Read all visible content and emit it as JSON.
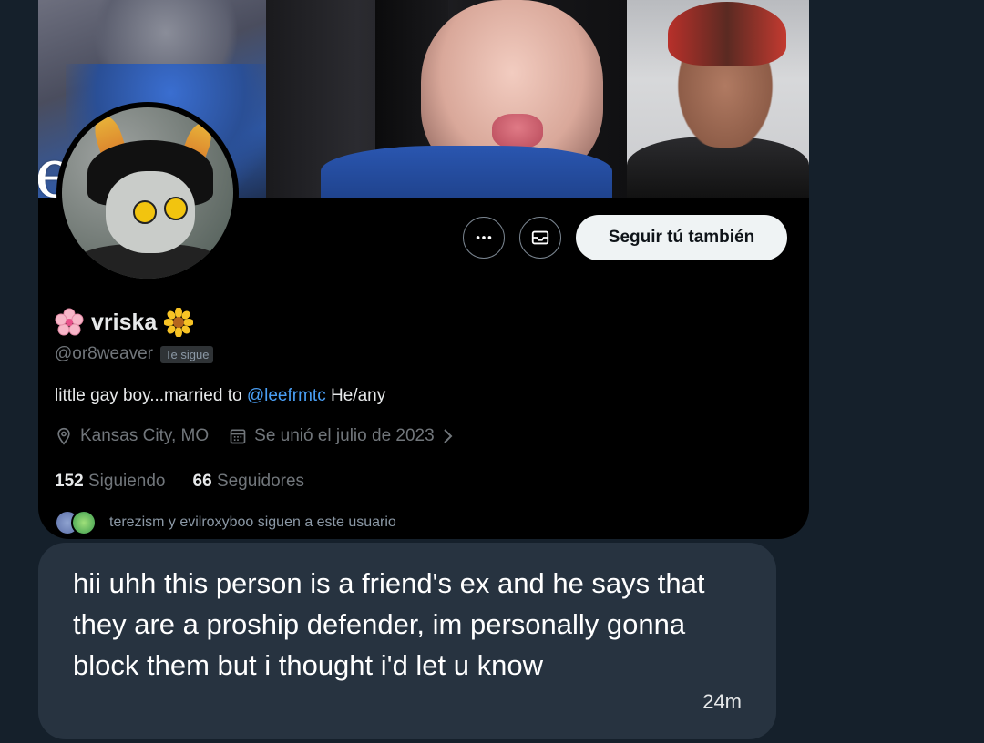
{
  "profile": {
    "banner_text": "eaver",
    "display_name": "vriska",
    "left_emoji": "cherry-blossom-icon",
    "right_emoji": "sunflower-icon",
    "handle": "@or8weaver",
    "follows_you_badge": "Te sigue",
    "bio_prefix": "little gay boy...married to ",
    "bio_mention": "@leefrmtc",
    "bio_suffix": " He/any",
    "location": "Kansas City, MO",
    "joined": "Se unió el julio de 2023",
    "following_count": "152",
    "following_label": "Siguiendo",
    "followers_count": "66",
    "followers_label": "Seguidores",
    "followed_by_text": "terezism y evilroxyboo siguen a este usuario",
    "buttons": {
      "more_icon": "more-icon",
      "message_icon": "message-icon",
      "follow_back_label": "Seguir tú también"
    }
  },
  "message": {
    "text": "hii uhh this person is a friend's ex and he says that they are a proship defender, im personally gonna block them but i thought i'd let u know",
    "time": "24m"
  },
  "colors": {
    "background": "#15202b",
    "card": "#000000",
    "bubble": "#273340",
    "mention": "#4a9ff5",
    "muted": "#71767b"
  }
}
